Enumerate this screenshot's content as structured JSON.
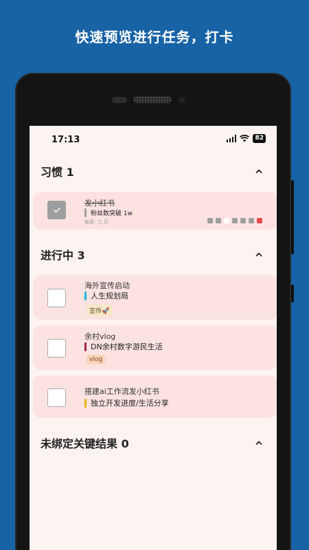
{
  "headline": "快速预览进行任务，打卡",
  "status": {
    "time": "17:13",
    "battery": "82"
  },
  "sections": {
    "habits": {
      "title": "习惯 1"
    },
    "in_progress": {
      "title": "进行中 3"
    },
    "unbound": {
      "title": "未绑定关键结果 0"
    }
  },
  "habit": {
    "title": "发小红书",
    "key_result": "粉丝数突破 1w",
    "key_result_color": "#9e9e9e",
    "frequency": "每周: 三,日",
    "checked": true,
    "week_dots": [
      "#9e9e9e",
      "#9e9e9e",
      "#ffffff",
      "#9e9e9e",
      "#9e9e9e",
      "#9e9e9e",
      "#e84a4a"
    ]
  },
  "tasks": [
    {
      "title": "海外宣传启动",
      "key_result": "人生规划局",
      "key_result_color": "#19b4d8",
      "tag": "宣传🚀",
      "checked": false
    },
    {
      "title": "余村vlog",
      "key_result": "DN余村数字游民生活",
      "key_result_color": "#a3204a",
      "tag": "vlog",
      "checked": false
    },
    {
      "title": "搭建ai工作流发小红书",
      "key_result": "独立开发进度/生活分享",
      "key_result_color": "#e8b400",
      "tag": "",
      "checked": false
    }
  ],
  "colors": {
    "background": "#1763a6",
    "screen": "#fdf3f1",
    "card": "#fce3e2"
  },
  "icons": {
    "collapse": "chevron-up-icon",
    "check": "check-icon"
  }
}
